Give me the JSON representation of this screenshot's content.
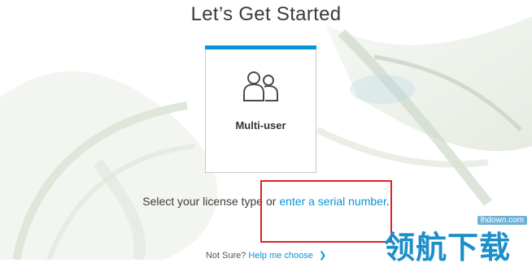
{
  "page": {
    "title": "Let’s Get Started"
  },
  "card": {
    "label": "Multi-user",
    "icon": "multi-user-icon",
    "accent": "#0696d7"
  },
  "license": {
    "prefix": "Select your license type or ",
    "link": "enter a serial number",
    "suffix": "."
  },
  "footer": {
    "prefix": "Not Sure?",
    "link": "Help me choose",
    "chevron": "❯"
  },
  "watermark": {
    "domain": "lhdown.com",
    "text": "领航下载"
  },
  "colors": {
    "link": "#0696d7",
    "highlight": "#e0202a"
  }
}
